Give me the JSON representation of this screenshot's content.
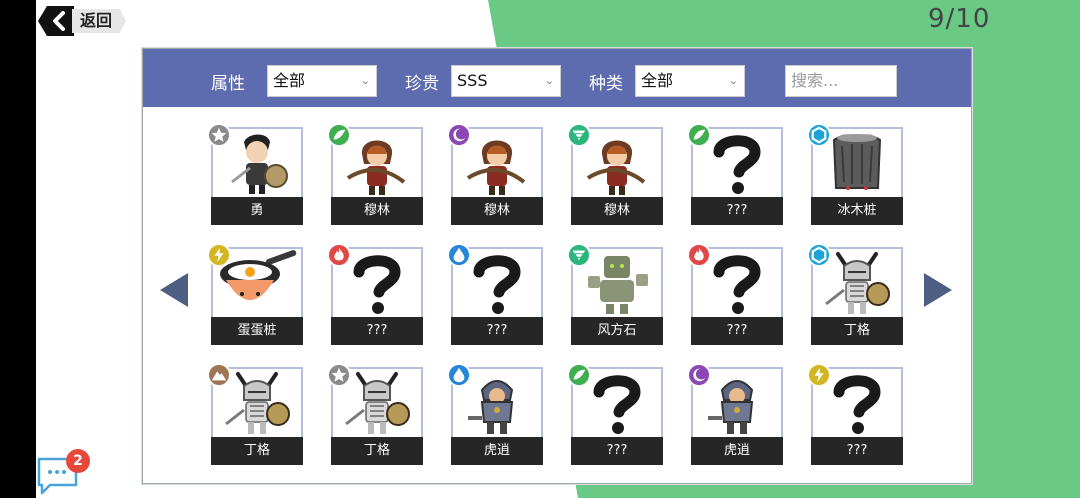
{
  "header": {
    "back_label": "返回",
    "page_indicator": "9/10"
  },
  "filters": {
    "attr_label": "属性",
    "attr_value": "全部",
    "rarity_label": "珍贵",
    "rarity_value": "SSS",
    "kind_label": "种类",
    "kind_value": "全部",
    "search_placeholder": "搜索..."
  },
  "cards": [
    {
      "name": "勇",
      "element": "star",
      "color": "#8a8a8a",
      "art": "knight-hero"
    },
    {
      "name": "穆林",
      "element": "wind",
      "color": "#3fae4f",
      "art": "hooded-archer"
    },
    {
      "name": "穆林",
      "element": "moon",
      "color": "#8a47b5",
      "art": "hooded-archer"
    },
    {
      "name": "穆林",
      "element": "tornado",
      "color": "#2bb57f",
      "art": "hooded-archer"
    },
    {
      "name": "???",
      "element": "wind",
      "color": "#3fae4f",
      "art": "question-mark"
    },
    {
      "name": "冰木桩",
      "element": "hexagon",
      "color": "#1ea3d6",
      "art": "ice-stump"
    },
    {
      "name": "蛋蛋桩",
      "element": "lightning",
      "color": "#d3b722",
      "art": "egg-pan"
    },
    {
      "name": "???",
      "element": "fire",
      "color": "#e04848",
      "art": "question-mark"
    },
    {
      "name": "???",
      "element": "water",
      "color": "#2585d8",
      "art": "question-mark"
    },
    {
      "name": "风方石",
      "element": "tornado",
      "color": "#2bb57f",
      "art": "wind-stone"
    },
    {
      "name": "???",
      "element": "fire",
      "color": "#e04848",
      "art": "question-mark"
    },
    {
      "name": "丁格",
      "element": "hexagon",
      "color": "#1ea3d6",
      "art": "horned-skeleton"
    },
    {
      "name": "丁格",
      "element": "mountain",
      "color": "#a07454",
      "art": "horned-skeleton"
    },
    {
      "name": "丁格",
      "element": "star",
      "color": "#8a8a8a",
      "art": "horned-skeleton"
    },
    {
      "name": "虎逍",
      "element": "water",
      "color": "#2585d8",
      "art": "armored-warrior"
    },
    {
      "name": "???",
      "element": "wind",
      "color": "#3fae4f",
      "art": "question-mark"
    },
    {
      "name": "虎逍",
      "element": "moon",
      "color": "#8a47b5",
      "art": "armored-warrior"
    },
    {
      "name": "???",
      "element": "lightning",
      "color": "#d3b722",
      "art": "question-mark"
    }
  ],
  "chat": {
    "unread_count": "2"
  }
}
